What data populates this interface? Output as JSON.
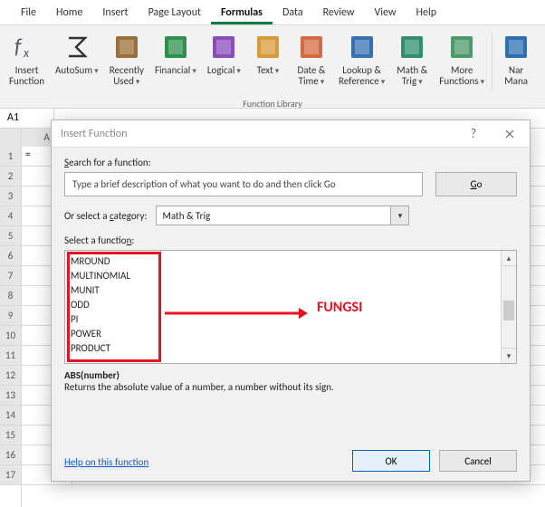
{
  "tabs": [
    "File",
    "Home",
    "Insert",
    "Page Layout",
    "Formulas",
    "Data",
    "Review",
    "View",
    "Help"
  ],
  "active_tab_index": 4,
  "ribbon": {
    "group_label": "Function Library",
    "buttons": [
      {
        "name": "insert-function",
        "label": "Insert\nFunction",
        "drop": false
      },
      {
        "name": "autosum",
        "label": "AutoSum",
        "drop": true
      },
      {
        "name": "recently-used",
        "label": "Recently\nUsed",
        "drop": true
      },
      {
        "name": "financial",
        "label": "Financial",
        "drop": true
      },
      {
        "name": "logical",
        "label": "Logical",
        "drop": true
      },
      {
        "name": "text",
        "label": "Text",
        "drop": true
      },
      {
        "name": "date-time",
        "label": "Date &\nTime",
        "drop": true
      },
      {
        "name": "lookup-reference",
        "label": "Lookup &\nReference",
        "drop": true
      },
      {
        "name": "math-trig",
        "label": "Math &\nTrig",
        "drop": true
      },
      {
        "name": "more-functions",
        "label": "More\nFunctions",
        "drop": true
      },
      {
        "name": "name-manager",
        "label": "Nar\nMana",
        "drop": false
      }
    ]
  },
  "namebox": "A1",
  "columns": [
    "A"
  ],
  "rows": [
    1,
    2,
    3,
    4,
    5,
    6,
    7,
    8,
    9,
    10,
    11,
    12,
    13,
    14,
    15,
    16,
    17
  ],
  "cell_a1": "=",
  "dialog": {
    "title": "Insert Function",
    "search_label": "Search for a function:",
    "search_hint": "Type a brief description of what you want to do and then click Go",
    "go_label": "Go",
    "category_label": "Or select a category:",
    "category_value": "Math & Trig",
    "select_label": "Select a function:",
    "functions": [
      "MROUND",
      "MULTINOMIAL",
      "MUNIT",
      "ODD",
      "PI",
      "POWER",
      "PRODUCT"
    ],
    "annotation": "FUNGSI",
    "signature": "ABS(number)",
    "description": "Returns the absolute value of a number, a number without its sign.",
    "help_link": "Help on this function",
    "ok": "OK",
    "cancel": "Cancel"
  }
}
